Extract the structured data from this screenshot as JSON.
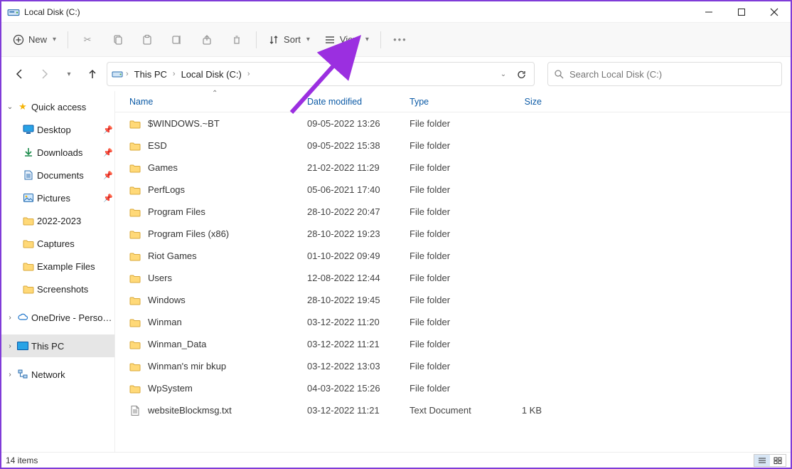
{
  "window": {
    "title": "Local Disk (C:)"
  },
  "cmdbar": {
    "new_label": "New",
    "sort_label": "Sort",
    "view_label": "View"
  },
  "breadcrumb": {
    "root": "This PC",
    "loc": "Local Disk (C:)"
  },
  "search": {
    "placeholder": "Search Local Disk (C:)"
  },
  "sidebar": {
    "quick_access": "Quick access",
    "pinned": [
      {
        "kind": "desktop",
        "label": "Desktop"
      },
      {
        "kind": "downloads",
        "label": "Downloads"
      },
      {
        "kind": "documents",
        "label": "Documents"
      },
      {
        "kind": "pictures",
        "label": "Pictures"
      }
    ],
    "recent": [
      {
        "label": "2022-2023"
      },
      {
        "label": "Captures"
      },
      {
        "label": "Example Files"
      },
      {
        "label": "Screenshots"
      }
    ],
    "onedrive": "OneDrive - Personal",
    "this_pc": "This PC",
    "network": "Network"
  },
  "columns": {
    "name": "Name",
    "date": "Date modified",
    "type": "Type",
    "size": "Size"
  },
  "types": {
    "folder": "File folder",
    "text": "Text Document"
  },
  "files": [
    {
      "icon": "folder",
      "name": "$WINDOWS.~BT",
      "date": "09-05-2022 13:26",
      "typekey": "folder",
      "size": ""
    },
    {
      "icon": "folder",
      "name": "ESD",
      "date": "09-05-2022 15:38",
      "typekey": "folder",
      "size": ""
    },
    {
      "icon": "folder",
      "name": "Games",
      "date": "21-02-2022 11:29",
      "typekey": "folder",
      "size": ""
    },
    {
      "icon": "folder",
      "name": "PerfLogs",
      "date": "05-06-2021 17:40",
      "typekey": "folder",
      "size": ""
    },
    {
      "icon": "folder",
      "name": "Program Files",
      "date": "28-10-2022 20:47",
      "typekey": "folder",
      "size": ""
    },
    {
      "icon": "folder",
      "name": "Program Files (x86)",
      "date": "28-10-2022 19:23",
      "typekey": "folder",
      "size": ""
    },
    {
      "icon": "folder",
      "name": "Riot Games",
      "date": "01-10-2022 09:49",
      "typekey": "folder",
      "size": ""
    },
    {
      "icon": "folder",
      "name": "Users",
      "date": "12-08-2022 12:44",
      "typekey": "folder",
      "size": ""
    },
    {
      "icon": "folder",
      "name": "Windows",
      "date": "28-10-2022 19:45",
      "typekey": "folder",
      "size": ""
    },
    {
      "icon": "folder",
      "name": "Winman",
      "date": "03-12-2022 11:20",
      "typekey": "folder",
      "size": ""
    },
    {
      "icon": "folder",
      "name": "Winman_Data",
      "date": "03-12-2022 11:21",
      "typekey": "folder",
      "size": ""
    },
    {
      "icon": "folder",
      "name": "Winman's mir bkup",
      "date": "03-12-2022 13:03",
      "typekey": "folder",
      "size": ""
    },
    {
      "icon": "folder",
      "name": "WpSystem",
      "date": "04-03-2022 15:26",
      "typekey": "folder",
      "size": ""
    },
    {
      "icon": "text",
      "name": "websiteBlockmsg.txt",
      "date": "03-12-2022 11:21",
      "typekey": "text",
      "size": "1 KB"
    }
  ],
  "status": {
    "items": "14 items"
  }
}
